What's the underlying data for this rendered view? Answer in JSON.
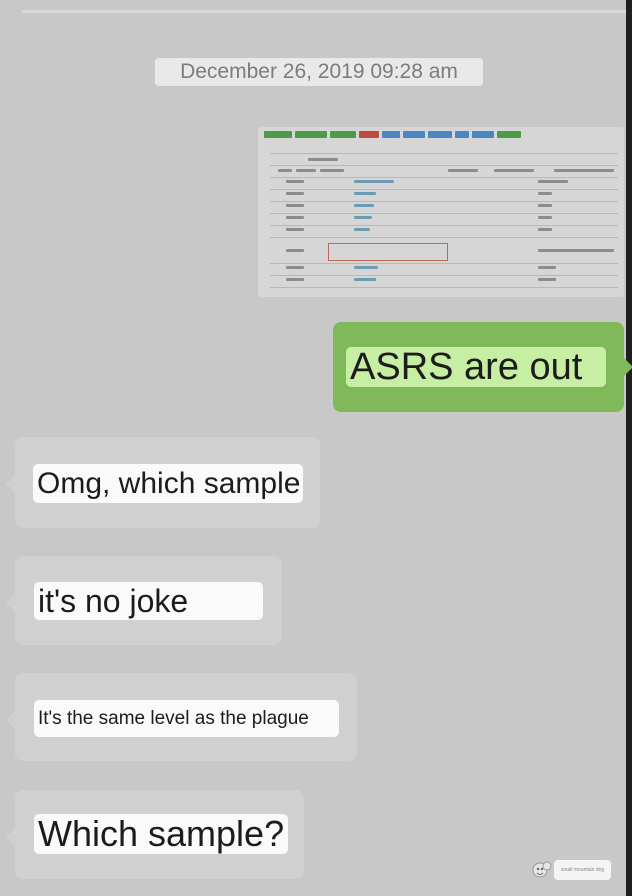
{
  "chat": {
    "timestamp": "December 26, 2019 09:28 am",
    "messages": [
      {
        "side": "right",
        "kind": "image",
        "description_icon": "spreadsheet-screenshot-image"
      },
      {
        "side": "right",
        "kind": "text",
        "text": "ASRS are out"
      },
      {
        "side": "left",
        "kind": "text",
        "text": "Omg, which sample"
      },
      {
        "side": "left",
        "kind": "text",
        "text": "it's no joke"
      },
      {
        "side": "left",
        "kind": "text",
        "text": "It's the same level as the plague"
      },
      {
        "side": "left",
        "kind": "text",
        "text": "Which sample?"
      }
    ]
  },
  "watermark": {
    "text": "small mountain dog",
    "icon": "dog-logo-icon"
  },
  "colors": {
    "background": "#c8c8c8",
    "outgoing_bubble": "#80b95a",
    "outgoing_text_bg": "#c7efa4",
    "incoming_bubble": "#d0d0d0",
    "incoming_text_bg": "#fafafa",
    "timestamp_bg": "#e9e9e9"
  }
}
